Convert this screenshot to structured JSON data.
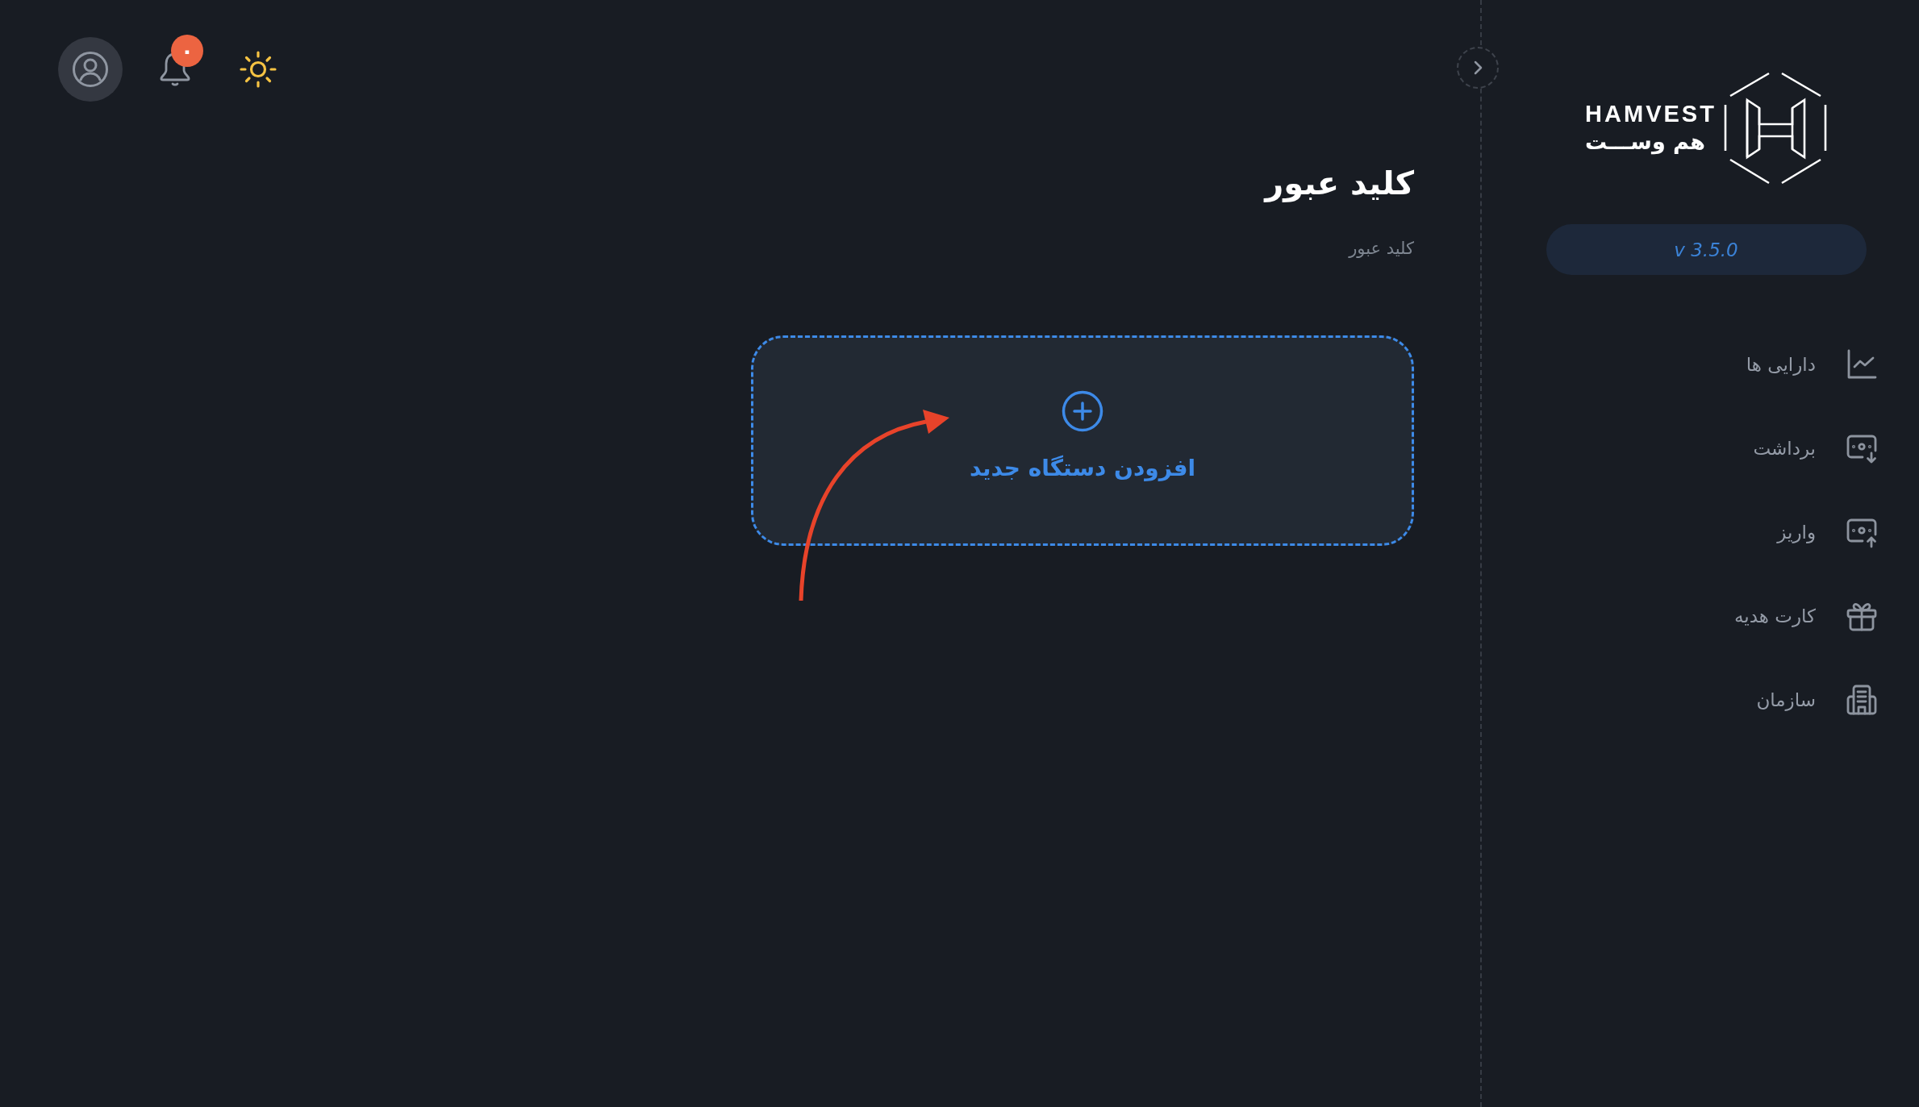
{
  "header": {
    "notification_count": "۰"
  },
  "page": {
    "title": "کلید عبور",
    "subtitle": "کلید عبور"
  },
  "add_device": {
    "label": "افزودن دستگاه جدید"
  },
  "sidebar": {
    "logo": {
      "latin": "HAMVEST",
      "persian": "هم وســـت"
    },
    "version": "v 3.5.0",
    "items": [
      {
        "label": "دارایی ها",
        "selected": false
      },
      {
        "label": "برداشت",
        "selected": false
      },
      {
        "label": "واریز",
        "selected": false
      },
      {
        "label": "کارت هدیه",
        "selected": false
      },
      {
        "label": "سازمان",
        "selected": false
      }
    ]
  }
}
